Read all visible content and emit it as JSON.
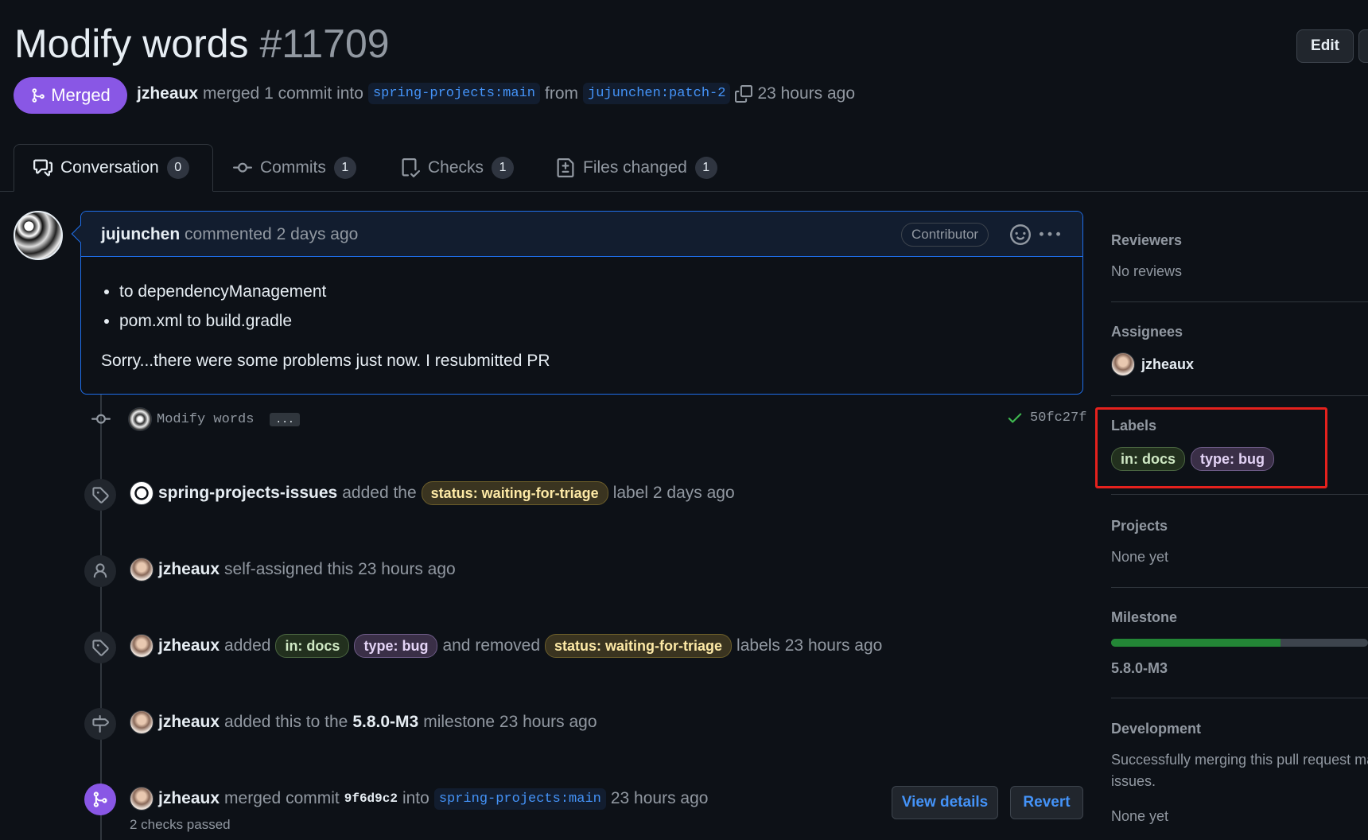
{
  "pr": {
    "title": "Modify words",
    "number": "#11709",
    "status": "Merged",
    "merger": "jzheaux",
    "merge_text": "merged 1 commit into",
    "base_branch": "spring-projects:main",
    "from_text": "from",
    "head_branch": "jujunchen:patch-2",
    "time": "23 hours ago"
  },
  "header": {
    "edit_label": "Edit"
  },
  "tabs": [
    {
      "label": "Conversation",
      "count": "0"
    },
    {
      "label": "Commits",
      "count": "1"
    },
    {
      "label": "Checks",
      "count": "1"
    },
    {
      "label": "Files changed",
      "count": "1"
    }
  ],
  "comment": {
    "author": "jujunchen",
    "meta": "commented 2 days ago",
    "badge": "Contributor",
    "bullets": [
      "to dependencyManagement",
      "pom.xml to build.gradle"
    ],
    "text": "Sorry...there were some problems just now. I resubmitted PR"
  },
  "commit": {
    "message": "Modify words",
    "ellipsis": "...",
    "sha": "50fc27f"
  },
  "events": {
    "e1": {
      "actor": "spring-projects-issues",
      "pre": "added the",
      "label": "status: waiting-for-triage",
      "post": "label 2 days ago"
    },
    "e2": {
      "actor": "jzheaux",
      "text": "self-assigned this 23 hours ago"
    },
    "e3": {
      "actor": "jzheaux",
      "pre": "added",
      "label1": "in: docs",
      "label2": "type: bug",
      "mid": "and removed",
      "label3": "status: waiting-for-triage",
      "post": "labels 23 hours ago"
    },
    "e4": {
      "actor": "jzheaux",
      "pre": "added this to the",
      "milestone": "5.8.0-M3",
      "post": "milestone 23 hours ago"
    },
    "e5": {
      "actor": "jzheaux",
      "pre": "merged commit",
      "sha": "9f6d9c2",
      "mid": "into",
      "branch": "spring-projects:main",
      "post": "23 hours ago",
      "checks": "2 checks passed",
      "view_details": "View details",
      "revert": "Revert"
    }
  },
  "sidebar": {
    "reviewers": {
      "title": "Reviewers",
      "value": "No reviews"
    },
    "assignees": {
      "title": "Assignees",
      "value": "jzheaux"
    },
    "labels": {
      "title": "Labels",
      "items": [
        "in: docs",
        "type: bug"
      ]
    },
    "projects": {
      "title": "Projects",
      "value": "None yet"
    },
    "milestone": {
      "title": "Milestone",
      "value": "5.8.0-M3",
      "progress": 0.66
    },
    "development": {
      "title": "Development",
      "text1": "Successfully merging this pull request ma",
      "text2": "issues.",
      "value": "None yet"
    }
  },
  "colors": {
    "merged": "#8957e5",
    "link": "#4493f8",
    "highlight": "#e5211d",
    "progress": "#238636"
  }
}
